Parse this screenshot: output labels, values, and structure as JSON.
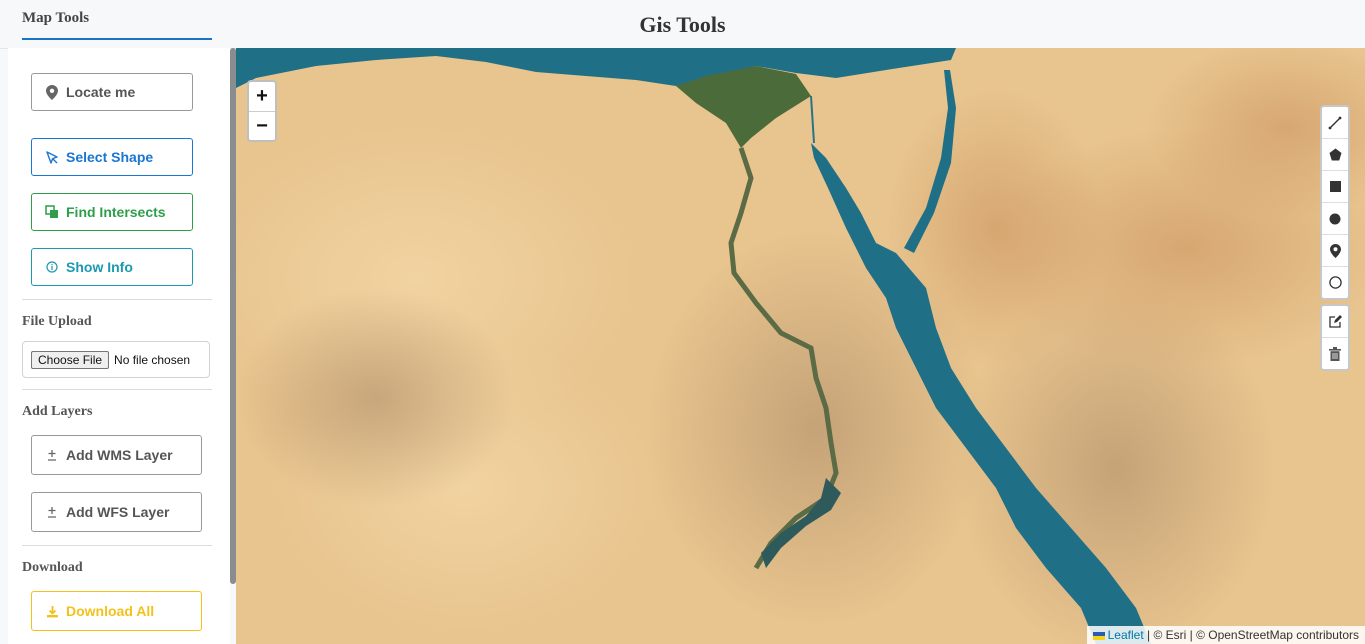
{
  "header": {
    "title": "Gis Tools",
    "sidebar_tab": "Map Tools"
  },
  "sidebar": {
    "buttons": {
      "locate": "Locate me",
      "select_shape": "Select Shape",
      "find_intersects": "Find Intersects",
      "show_info": "Show Info"
    },
    "file_upload": {
      "title": "File Upload",
      "choose_label": "Choose File",
      "status": "No file chosen"
    },
    "add_layers": {
      "title": "Add Layers",
      "wms": "Add WMS Layer",
      "wfs": "Add WFS Layer"
    },
    "download": {
      "title": "Download",
      "all": "Download All"
    }
  },
  "map": {
    "zoom_in": "+",
    "zoom_out": "−",
    "attribution": {
      "leaflet": "Leaflet",
      "rest": " | © Esri | © OpenStreetMap contributors"
    },
    "draw_tools": [
      "polyline-icon",
      "polygon-icon",
      "rectangle-icon",
      "circle-icon",
      "marker-icon",
      "circlemarker-icon"
    ],
    "edit_tools": [
      "edit-icon",
      "trash-icon"
    ]
  },
  "colors": {
    "blue": "#1976d2",
    "green": "#2e9e4b",
    "teal": "#1b99b3",
    "yellow": "#f2c21b",
    "sea": "#1f6f86",
    "desert": "#e9c590"
  }
}
